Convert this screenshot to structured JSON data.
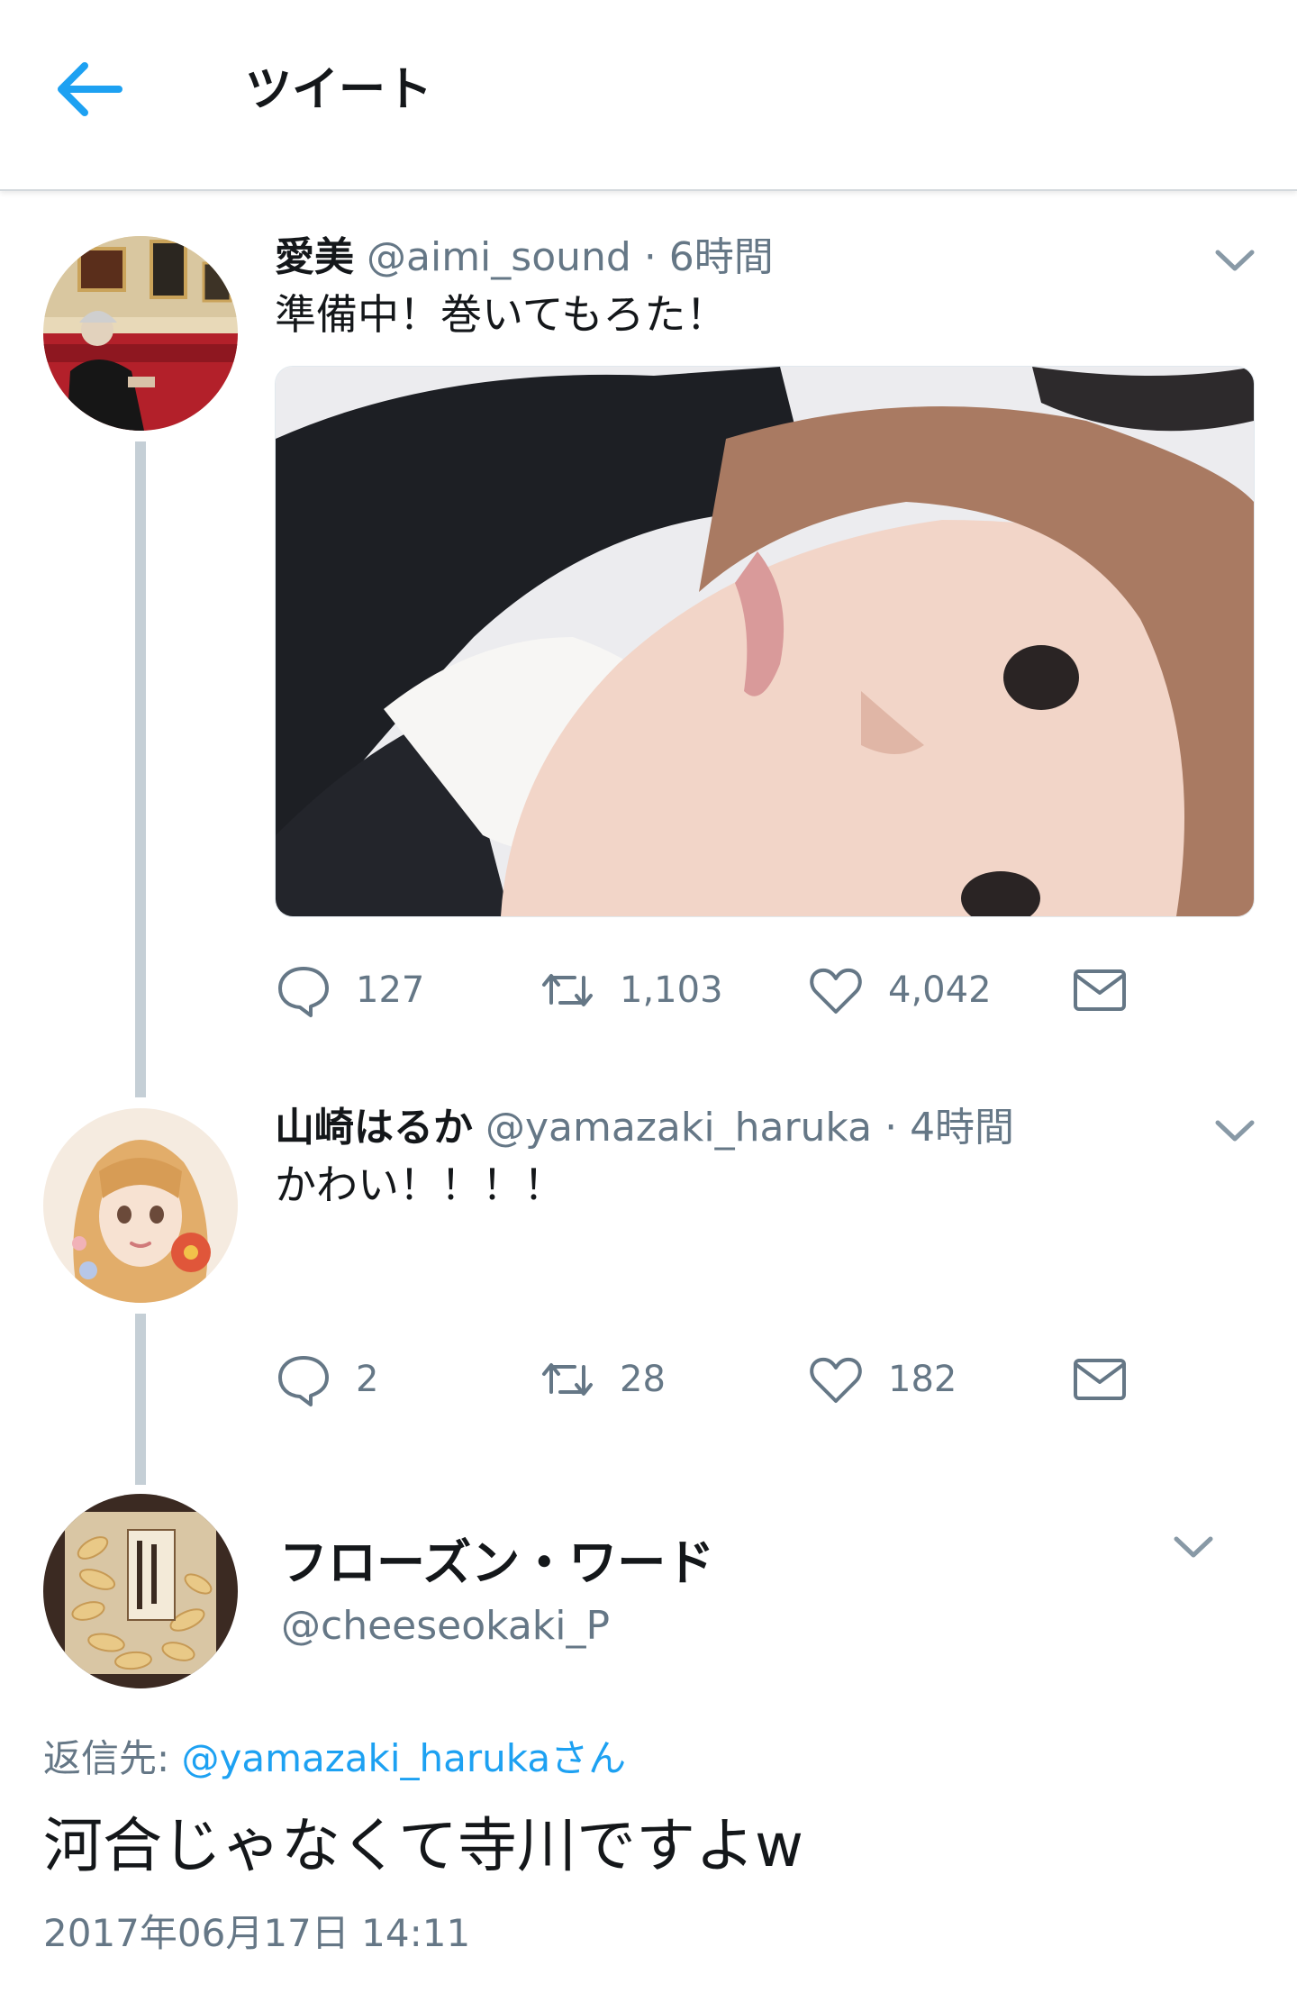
{
  "header": {
    "title": "ツイート"
  },
  "tweets": [
    {
      "name": "愛美",
      "handle": "@aimi_sound",
      "time": "· 6時間",
      "text": "準備中！巻いてもろた！",
      "replies": "127",
      "retweets": "1,103",
      "likes": "4,042"
    },
    {
      "name": "山崎はるか",
      "handle": "@yamazaki_haruka",
      "time": "· 4時間",
      "text": "かわい！！！！",
      "replies": "2",
      "retweets": "28",
      "likes": "182"
    }
  ],
  "focused": {
    "name": "フローズン・ワード",
    "handle": "@cheeseokaki_P",
    "reply_to_label": "返信先: ",
    "reply_to_user": "@yamazaki_harukaさん",
    "text": "河合じゃなくて寺川ですよw",
    "timestamp": "2017年06月17日 14:11"
  },
  "colors": {
    "accent": "#1da1f2",
    "secondary": "#657786",
    "thread_line": "#c5cfd6"
  },
  "icons": [
    "back-arrow-icon",
    "chevron-down-icon",
    "reply-icon",
    "retweet-icon",
    "like-icon",
    "mail-icon"
  ]
}
